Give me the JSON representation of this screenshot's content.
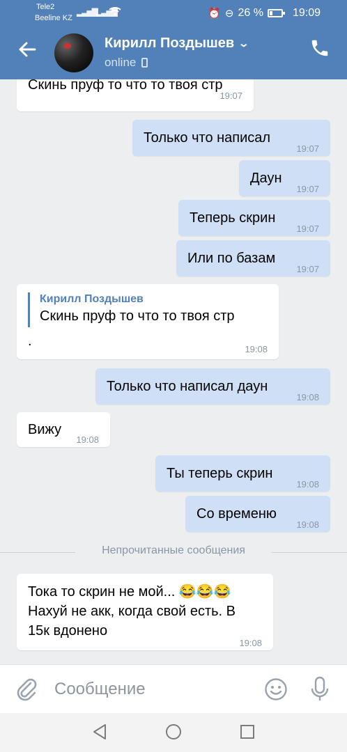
{
  "status_bar": {
    "carrier_1": "Tele2",
    "carrier_2": "Beeline KZ",
    "battery": "26 %",
    "time": "19:09"
  },
  "header": {
    "contact_name": "Кирилл Поздышев",
    "contact_status": "online"
  },
  "messages": [
    {
      "dir": "in",
      "text": "Скинь пруф то что то твоя стр",
      "time": "19:07"
    },
    {
      "dir": "out",
      "text": "Только что написал",
      "time": "19:07"
    },
    {
      "dir": "out",
      "text": "Даун",
      "time": "19:07"
    },
    {
      "dir": "out",
      "text": "Теперь скрин",
      "time": "19:07"
    },
    {
      "dir": "out",
      "text": "Или по базам",
      "time": "19:07"
    },
    {
      "dir": "in",
      "reply_author": "Кирилл Поздышев",
      "reply_text": "Скинь пруф то что то твоя стр",
      "text": ".",
      "time": "19:08"
    },
    {
      "dir": "out",
      "text": "Только что написал даун",
      "time": "19:08"
    },
    {
      "dir": "in",
      "text": "Вижу",
      "time": "19:08"
    },
    {
      "dir": "out",
      "text": "Ты теперь скрин",
      "time": "19:08"
    },
    {
      "dir": "out",
      "text": "Со временю",
      "time": "19:08"
    },
    {
      "dir": "in",
      "text_line_1": "Тока то скрин не мой... 😂😂😂",
      "text_line_2": "Нахуй не акк, когда свой есть. В",
      "text_line_3": "15к вдонено",
      "time": "19:08"
    }
  ],
  "unread_divider": "Непрочитанные сообщения",
  "input": {
    "placeholder": "Сообщение"
  },
  "colors": {
    "header_bg": "#5181b8",
    "chat_bg": "#edeef0",
    "outgoing_bubble": "#cfe0f6",
    "incoming_bubble": "#ffffff"
  }
}
